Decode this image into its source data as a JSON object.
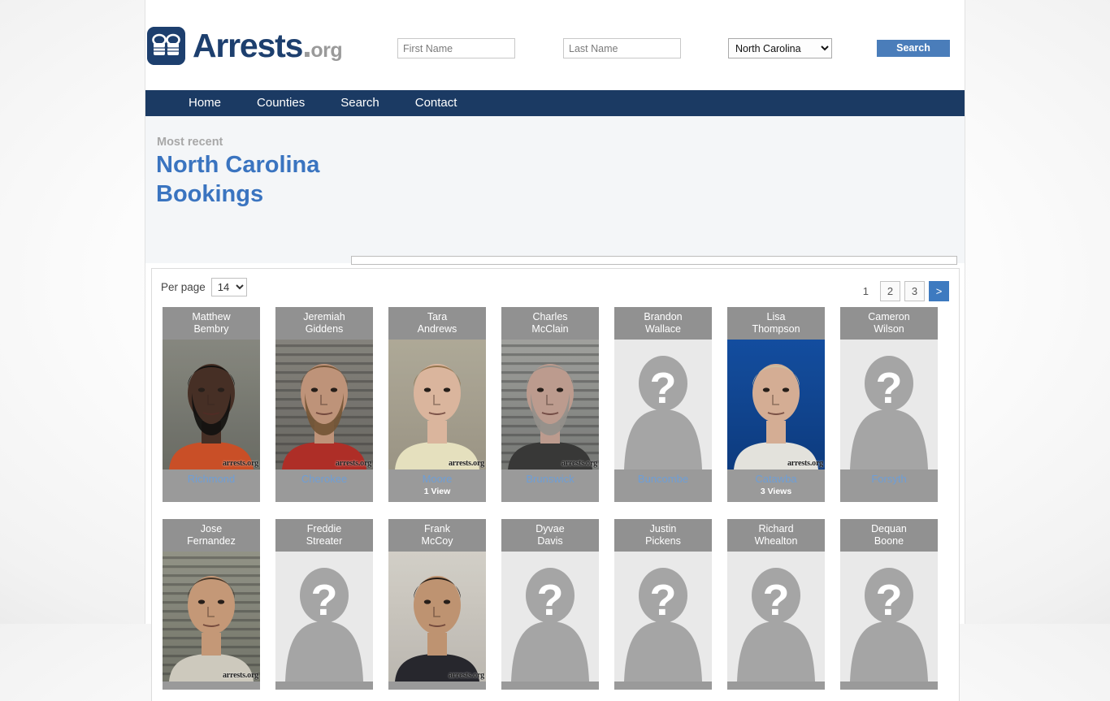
{
  "site": {
    "logo_text": "Arrests",
    "logo_dot": ".",
    "logo_org": "org",
    "logo_icon": "handcuffs-icon"
  },
  "search": {
    "first_name_placeholder": "First Name",
    "first_name_value": "",
    "last_name_placeholder": "Last Name",
    "last_name_value": "",
    "state_selected": "North Carolina",
    "search_label": "Search"
  },
  "nav": {
    "items": [
      {
        "label": "Home"
      },
      {
        "label": "Counties"
      },
      {
        "label": "Search"
      },
      {
        "label": "Contact"
      }
    ]
  },
  "intro": {
    "eyebrow": "Most recent",
    "title": "North Carolina Bookings"
  },
  "toolbar": {
    "per_page_label": "Per page",
    "per_page_value": "14"
  },
  "pagination": {
    "current": "1",
    "page2": "2",
    "page3": "3",
    "next": ">"
  },
  "watermark": "arrests.org",
  "colors": {
    "brand_navy": "#1b3a63",
    "link_blue": "#3a74c0",
    "button_blue": "#4a7dba",
    "card_gray": "#9a9a9a",
    "panel_bg": "#f4f6f8"
  },
  "cards": [
    {
      "first": "Matthew",
      "last": "Bembry",
      "county": "Richmond",
      "views": "",
      "photo": "mug-bembry",
      "has_photo": true
    },
    {
      "first": "Jeremiah",
      "last": "Giddens",
      "county": "Cherokee",
      "views": "",
      "photo": "mug-giddens",
      "has_photo": true
    },
    {
      "first": "Tara",
      "last": "Andrews",
      "county": "Moore",
      "views": "1 View",
      "photo": "mug-andrews",
      "has_photo": true
    },
    {
      "first": "Charles",
      "last": "McClain",
      "county": "Brunswick",
      "views": "",
      "photo": "mug-mcclain",
      "has_photo": true
    },
    {
      "first": "Brandon",
      "last": "Wallace",
      "county": "Buncombe",
      "views": "",
      "photo": "placeholder",
      "has_photo": false
    },
    {
      "first": "Lisa",
      "last": "Thompson",
      "county": "Catawba",
      "views": "3 Views",
      "photo": "mug-thompson",
      "has_photo": true
    },
    {
      "first": "Cameron",
      "last": "Wilson",
      "county": "Forsyth",
      "views": "",
      "photo": "placeholder",
      "has_photo": false
    },
    {
      "first": "Jose",
      "last": "Fernandez",
      "county": "",
      "views": "",
      "photo": "mug-fernandez",
      "has_photo": true
    },
    {
      "first": "Freddie",
      "last": "Streater",
      "county": "",
      "views": "",
      "photo": "placeholder",
      "has_photo": false
    },
    {
      "first": "Frank",
      "last": "McCoy",
      "county": "",
      "views": "",
      "photo": "mug-mccoy",
      "has_photo": true
    },
    {
      "first": "Dyvae",
      "last": "Davis",
      "county": "",
      "views": "",
      "photo": "placeholder",
      "has_photo": false
    },
    {
      "first": "Justin",
      "last": "Pickens",
      "county": "",
      "views": "",
      "photo": "placeholder",
      "has_photo": false
    },
    {
      "first": "Richard",
      "last": "Whealton",
      "county": "",
      "views": "",
      "photo": "placeholder",
      "has_photo": false
    },
    {
      "first": "Dequan",
      "last": "Boone",
      "county": "",
      "views": "",
      "photo": "placeholder",
      "has_photo": false
    }
  ]
}
